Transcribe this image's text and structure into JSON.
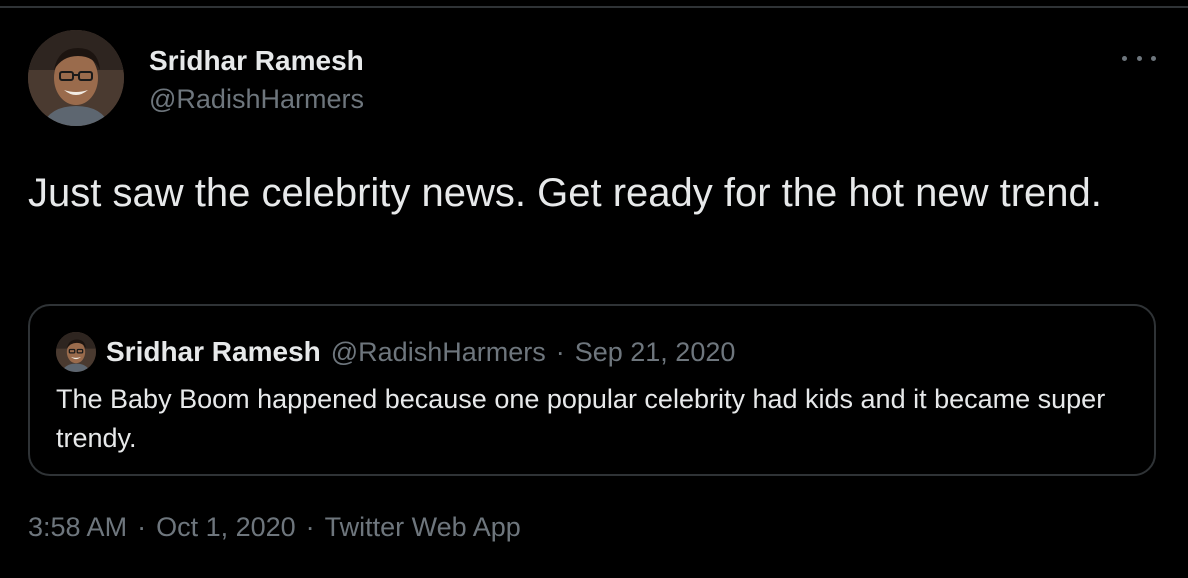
{
  "author": {
    "display_name": "Sridhar Ramesh",
    "handle": "@RadishHarmers"
  },
  "tweet": {
    "text": "Just saw the celebrity news. Get ready for the hot new trend."
  },
  "quoted_tweet": {
    "display_name": "Sridhar Ramesh",
    "handle": "@RadishHarmers",
    "separator": "·",
    "date": "Sep 21, 2020",
    "text": "The Baby Boom happened because one popular celebrity had kids and it became super trendy."
  },
  "meta": {
    "time": "3:58 AM",
    "separator": "·",
    "date": "Oct 1, 2020",
    "source": "Twitter Web App"
  },
  "icons": {
    "more": "more-horizontal-icon"
  },
  "colors": {
    "background": "#000000",
    "primary_text": "#e7e9ea",
    "secondary_text": "#6e767d",
    "border": "#2f3336"
  }
}
